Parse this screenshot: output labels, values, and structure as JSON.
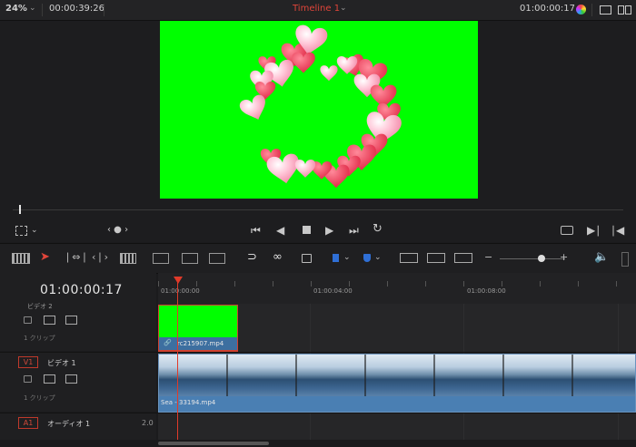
{
  "topbar": {
    "zoom": "24%",
    "source_timecode": "00:00:39:26",
    "timeline_name": "Timeline 1",
    "record_timecode": "01:00:00:17"
  },
  "timeline": {
    "timecode": "01:00:00:17",
    "ruler_labels": [
      "01:00:00:00",
      "01:00:04:00",
      "01:00:08:00"
    ],
    "tracks": {
      "v2": {
        "id": "V2",
        "name": "ビデオ 2",
        "clip_count": "1 クリップ"
      },
      "v1": {
        "id": "V1",
        "name": "ビデオ 1",
        "clip_count": "1 クリップ"
      },
      "a1": {
        "id": "A1",
        "name": "オーディオ 1",
        "channels": "2.0"
      }
    },
    "clips": {
      "green_clip": "rc215907.mp4",
      "sea_clip": "Sea - 33194.mp4"
    }
  },
  "colors": {
    "accent_red": "#e0453a",
    "accent_blue": "#2f6fd6",
    "green_screen": "#00ff00"
  },
  "icons": [
    "dropdown-icon",
    "color-icon",
    "single-viewer-icon",
    "dual-viewer-icon",
    "crop-icon",
    "dots-icon",
    "first-frame-icon",
    "prev-frame-icon",
    "stop-icon",
    "play-icon",
    "last-frame-icon",
    "loop-icon",
    "match-frame-icon",
    "next-edit-icon",
    "prev-edit-icon",
    "timeline-view-icon",
    "selection-icon",
    "trim-icon",
    "dynamic-trim-icon",
    "blade-icon",
    "insert-icon",
    "overwrite-icon",
    "replace-icon",
    "snap-icon",
    "link-icon",
    "lock-icon",
    "flag-icon",
    "marker-icon",
    "zoom-full-icon",
    "zoom-detail-icon",
    "zoom-custom-icon",
    "zoom-minus-icon",
    "zoom-plus-icon",
    "volume-icon",
    "lock-track-icon",
    "auto-select-icon",
    "monitor-icon",
    "link-clip-icon"
  ]
}
